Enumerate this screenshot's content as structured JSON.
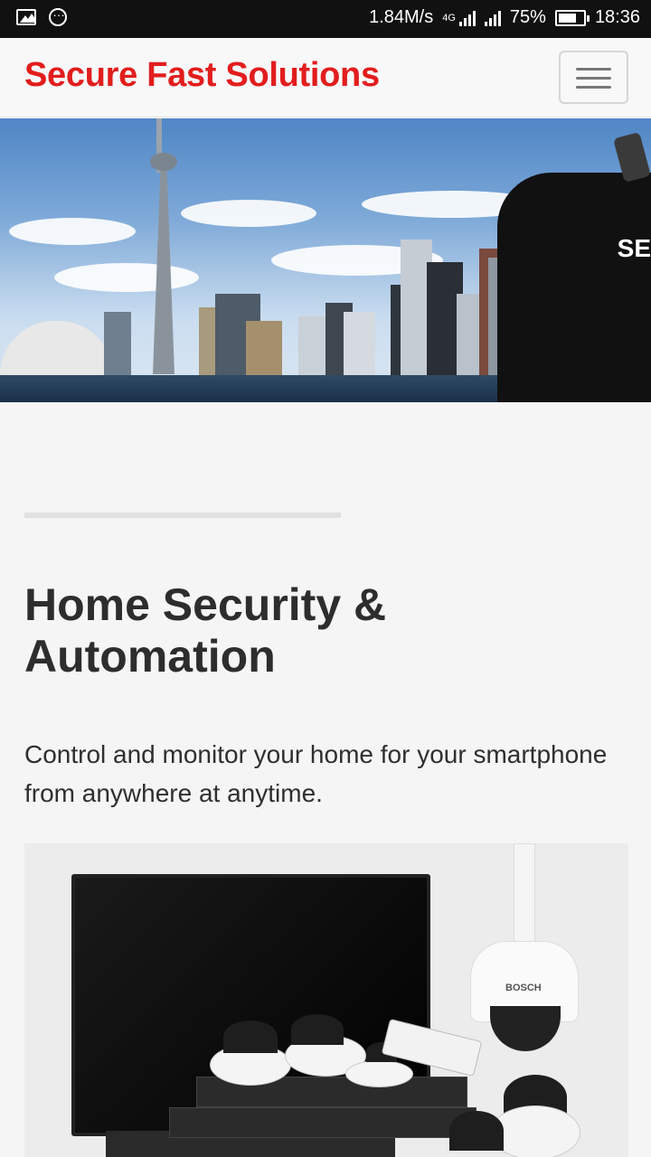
{
  "status_bar": {
    "speed": "1.84M/s",
    "network": "4G",
    "battery_percent": "75%",
    "battery_level": 0.75,
    "time": "18:36"
  },
  "navbar": {
    "brand": "Secure Fast Solutions",
    "menu_icon": "hamburger-menu-icon"
  },
  "hero": {
    "image": "toronto-skyline-security-guard",
    "guard_shirt_text": "SE"
  },
  "main": {
    "heading": "Home Security & Automation",
    "lead": "Control and monitor your home for your smartphone from anywhere at anytime.",
    "product_image": "bosch-cctv-cameras-monitor-nvr",
    "product_brand": "BOSCH"
  },
  "colors": {
    "brand": "#e21d1d",
    "background": "#f5f5f5"
  }
}
